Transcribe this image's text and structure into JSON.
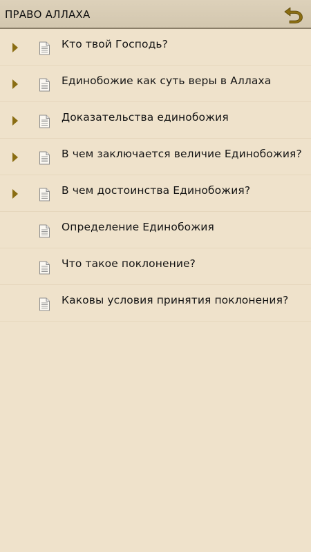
{
  "header": {
    "title": "ПРАВО АЛЛАХА",
    "back_icon": "undo-arrow-icon",
    "accent_color": "#8a6d12"
  },
  "list": {
    "items": [
      {
        "label": "Кто твой Господь?",
        "has_children": true
      },
      {
        "label": "Единобожие как суть веры в Аллаха",
        "has_children": true
      },
      {
        "label": "Доказательства единобожия",
        "has_children": true
      },
      {
        "label": "В чем заключается величие Единобожия?",
        "has_children": true
      },
      {
        "label": "В чем достоинства Единобожия?",
        "has_children": true
      },
      {
        "label": "Определение Единобожия",
        "has_children": false
      },
      {
        "label": "Что такое поклонение?",
        "has_children": false
      },
      {
        "label": "Каковы условия принятия поклонения?",
        "has_children": false
      }
    ]
  }
}
